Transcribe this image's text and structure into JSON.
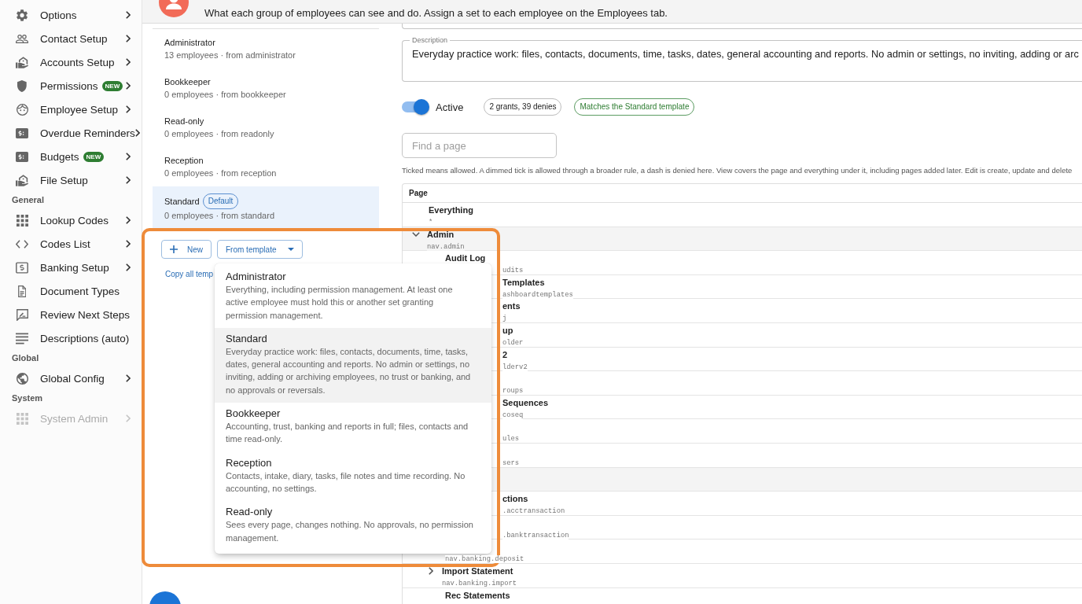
{
  "sidebar": {
    "sections": [
      {
        "items": [
          {
            "label": "Options",
            "submenu": true,
            "disabled": false
          },
          {
            "label": "Contact Setup",
            "submenu": true,
            "disabled": false
          },
          {
            "label": "Accounts Setup",
            "submenu": true,
            "disabled": false
          },
          {
            "label": "Permissions",
            "badge": "NEW",
            "submenu": true,
            "disabled": false
          },
          {
            "label": "Employee Setup",
            "submenu": true,
            "disabled": false
          },
          {
            "label": "Overdue Reminders",
            "submenu": true,
            "disabled": false
          },
          {
            "label": "Budgets",
            "badge": "NEW",
            "submenu": true,
            "disabled": false
          },
          {
            "label": "File Setup",
            "submenu": true,
            "disabled": false
          }
        ]
      },
      {
        "heading": "General",
        "items": [
          {
            "label": "Lookup Codes",
            "submenu": true,
            "disabled": false
          },
          {
            "label": "Codes List",
            "submenu": true,
            "disabled": false
          },
          {
            "label": "Banking Setup",
            "submenu": true,
            "disabled": false
          },
          {
            "label": "Document Types",
            "submenu": false,
            "disabled": false
          },
          {
            "label": "Review Next Steps",
            "submenu": false,
            "disabled": false
          },
          {
            "label": "Descriptions (auto)",
            "submenu": false,
            "disabled": false
          }
        ]
      },
      {
        "heading": "Global",
        "items": [
          {
            "label": "Global Config",
            "submenu": true,
            "disabled": false
          }
        ]
      },
      {
        "heading": "System",
        "items": [
          {
            "label": "System Admin",
            "submenu": true,
            "disabled": true
          }
        ]
      }
    ]
  },
  "header": {
    "subtitle": "What each group of employees can see and do. Assign a set to each employee on the Employees tab."
  },
  "permission_sets": {
    "items": [
      {
        "name": "Administrator",
        "meta": "13 employees · from administrator",
        "selected": false
      },
      {
        "name": "Bookkeeper",
        "meta": "0 employees · from bookkeeper",
        "selected": false
      },
      {
        "name": "Read-only",
        "meta": "0 employees · from readonly",
        "selected": false
      },
      {
        "name": "Reception",
        "meta": "0 employees · from reception",
        "selected": false
      },
      {
        "name": "Standard",
        "badge": "Default",
        "meta": "0 employees · from standard",
        "selected": true
      }
    ],
    "buttons": [
      {
        "label": "New",
        "kind": "add"
      },
      {
        "label": "From template",
        "kind": "menu"
      }
    ],
    "link": "Copy all temp"
  },
  "template_menu": {
    "items": [
      {
        "title": "Administrator",
        "description": "Everything, including permission management. At least one active employee must hold this or another set granting permission management.",
        "selected": false
      },
      {
        "title": "Standard",
        "description": "Everyday practice work: files, contacts, documents, time, tasks, dates, general accounting and reports. No admin or settings, no inviting, adding or archiving employees, no trust or banking, and no approvals or reversals.",
        "selected": true
      },
      {
        "title": "Bookkeeper",
        "description": "Accounting, trust, banking and reports in full; files, contacts and time read-only.",
        "selected": false
      },
      {
        "title": "Reception",
        "description": "Contacts, intake, diary, tasks, file notes and time recording. No accounting, no settings.",
        "selected": false
      },
      {
        "title": "Read-only",
        "description": "Sees every page, changes nothing. No approvals, no permission management.",
        "selected": false
      }
    ]
  },
  "detail": {
    "description": {
      "label": "Description",
      "value": "Everyday practice work: files, contacts, documents, time, tasks, dates, general accounting and reports. No admin or settings, no inviting, adding or arc"
    },
    "active": {
      "label": "Active",
      "on": true
    },
    "chips": [
      {
        "text": "2 grants, 39 denies",
        "kind": "count"
      },
      {
        "text": "Matches the Standard template",
        "kind": "match"
      }
    ],
    "search": {
      "placeholder": "Find a page"
    },
    "hint": "Ticked means allowed. A dimmed tick is allowed through a broader rule, a dash is denied here. View covers the page and everything under it, including pages added later. Edit is create, update and delete",
    "table": {
      "columns": [
        "Page"
      ],
      "rows": [
        {
          "kind": "page",
          "label": "Everything",
          "code": "*"
        },
        {
          "kind": "group",
          "label": "Admin",
          "code": "nav.admin",
          "expanded": true,
          "children": [
            {
              "kind": "clipped-code",
              "label": "Audit Log",
              "code": "udits"
            },
            {
              "kind": "clipped",
              "label": "Templates",
              "code": "ashboardtemplates"
            },
            {
              "kind": "clipped",
              "label": "ents",
              "code": "j"
            },
            {
              "kind": "clipped",
              "label": "up",
              "code": "older"
            },
            {
              "kind": "clipped",
              "label": "2",
              "code": "lderv2"
            },
            {
              "kind": "clipped",
              "code": "roups"
            },
            {
              "kind": "clipped",
              "label": "Sequences",
              "code": "coseq"
            },
            {
              "kind": "clipped",
              "code": "ules"
            },
            {
              "kind": "clipped",
              "code": "sers"
            }
          ]
        },
        {
          "kind": "covered-group",
          "children": [
            {
              "kind": "clipped",
              "label": "ctions",
              "code": ".acctransaction"
            },
            {
              "kind": "clipped",
              "code": ".banktransaction"
            },
            {
              "kind": "page",
              "code": "nav.banking.deposit"
            },
            {
              "kind": "group",
              "label": "Import Statement",
              "code": "nav.banking.import",
              "expanded": false
            },
            {
              "kind": "page",
              "label": "Rec Statements"
            }
          ]
        }
      ]
    }
  }
}
